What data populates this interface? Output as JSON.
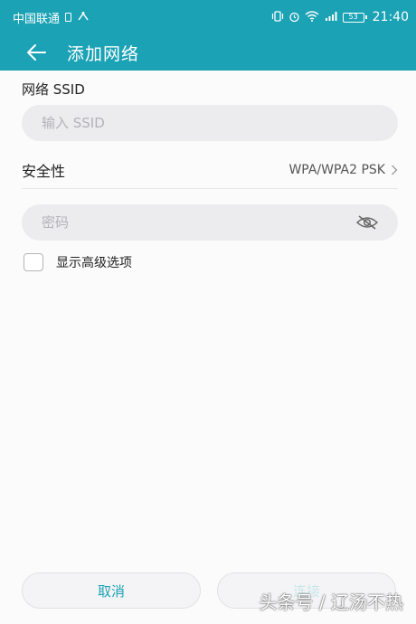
{
  "status_bar": {
    "carrier": "中国联通",
    "time": "21:40",
    "battery": "53",
    "network": "4G"
  },
  "app_bar": {
    "title": "添加网络"
  },
  "ssid": {
    "label": "网络 SSID",
    "placeholder": "输入 SSID",
    "value": ""
  },
  "security": {
    "label": "安全性",
    "value": "WPA/WPA2 PSK"
  },
  "password": {
    "placeholder": "密码",
    "value": ""
  },
  "advanced": {
    "label": "显示高级选项",
    "checked": false
  },
  "buttons": {
    "cancel": "取消",
    "connect": "连接"
  },
  "watermark": "头条号 / 辽汤不热",
  "colors": {
    "accent": "#1ba2b5",
    "field_bg": "#ececee",
    "disabled_text": "#c9e6ea"
  }
}
